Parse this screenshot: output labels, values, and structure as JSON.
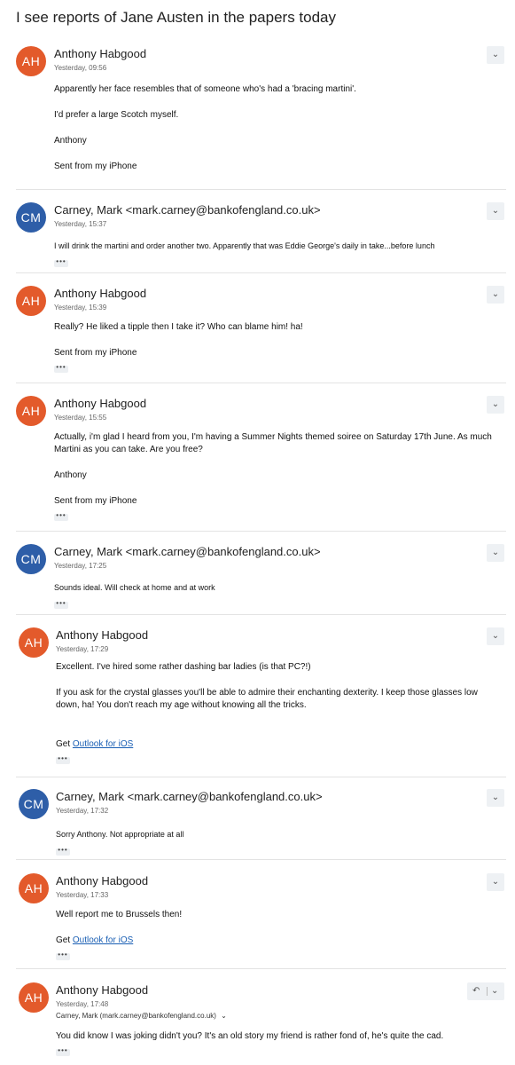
{
  "thread": {
    "title": "I see reports of Jane Austen in the papers today"
  },
  "icons": {
    "chevron": "chevron-down-icon",
    "more": "more-dots-icon",
    "reply": "reply-icon"
  },
  "colors": {
    "ah_avatar": "#e35a2b",
    "cm_avatar": "#2e5ea8",
    "link": "#1a5fb4"
  },
  "messages": [
    {
      "initials": "AH",
      "sender": "Anthony Habgood",
      "time": "Yesterday, 09:56",
      "paragraphs": [
        "Apparently her face resembles that of someone who's had a 'bracing martini'.",
        "I'd prefer a large Scotch myself.",
        "Anthony",
        "Sent from my iPhone"
      ]
    },
    {
      "initials": "CM",
      "sender": "Carney, Mark <mark.carney@bankofengland.co.uk>",
      "time": "Yesterday, 15:37",
      "paragraphs": [
        "I will drink the martini and order another two. Apparently that was Eddie George's daily in take...before lunch"
      ]
    },
    {
      "initials": "AH",
      "sender": "Anthony Habgood",
      "time": "Yesterday, 15:39",
      "paragraphs": [
        "Really? He liked a tipple then I take it? Who can blame him! ha!",
        "Sent from my iPhone"
      ]
    },
    {
      "initials": "AH",
      "sender": "Anthony Habgood",
      "time": "Yesterday, 15:55",
      "paragraphs": [
        "Actually, i'm glad I heard from you, I'm having a Summer Nights themed soiree on Saturday 17th June. As much Martini as you can take. Are you free?",
        "Anthony",
        "Sent from my iPhone"
      ]
    },
    {
      "initials": "CM",
      "sender": "Carney, Mark <mark.carney@bankofengland.co.uk>",
      "time": "Yesterday, 17:25",
      "paragraphs": [
        "Sounds ideal. Will check at home and at work"
      ]
    },
    {
      "initials": "AH",
      "sender": "Anthony Habgood",
      "time": "Yesterday, 17:29",
      "paragraphs": [
        "Excellent. I've hired some rather dashing bar ladies (is that PC?!)",
        "If you ask for the crystal glasses you'll be able to admire their enchanting dexterity. I keep those glasses low down, ha! You don't reach my age without knowing all the tricks."
      ],
      "get_label": "Get",
      "link_text": "Outlook for iOS"
    },
    {
      "initials": "CM",
      "sender": "Carney, Mark <mark.carney@bankofengland.co.uk>",
      "time": "Yesterday, 17:32",
      "paragraphs": [
        "Sorry Anthony.  Not appropriate at all"
      ]
    },
    {
      "initials": "AH",
      "sender": "Anthony Habgood",
      "time": "Yesterday, 17:33",
      "paragraphs": [
        "Well report me to Brussels then!"
      ],
      "get_label": "Get",
      "link_text": "Outlook for iOS"
    },
    {
      "initials": "AH",
      "sender": "Anthony Habgood",
      "time": "Yesterday, 17:48",
      "recipient": "Carney, Mark (mark.carney@bankofengland.co.uk)",
      "paragraphs": [
        "You did know I was joking didn't you? It's an old story my friend is rather fond of, he's quite the cad."
      ]
    }
  ],
  "glyphs": {
    "chevron": "⌄",
    "more": "•••",
    "reply": "↶",
    "expand": "⌄"
  }
}
